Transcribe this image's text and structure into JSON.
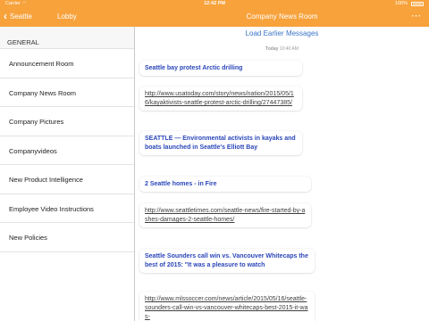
{
  "status_bar": {
    "carrier": "Carrier",
    "time": "12:42 PM",
    "battery": "100%"
  },
  "nav": {
    "back_label": "Seattle",
    "lobby_title": "Lobby",
    "room_title": "Company News Room",
    "more_icon": "ellipsis-icon"
  },
  "sidebar": {
    "section": "GENERAL",
    "items": [
      {
        "label": "Announcement Room"
      },
      {
        "label": "Company News Room"
      },
      {
        "label": "Company Pictures"
      },
      {
        "label": "Companyvideos"
      },
      {
        "label": "New Product Intelligence"
      },
      {
        "label": "Employee Video Instructions"
      },
      {
        "label": "New Policies"
      }
    ]
  },
  "chat": {
    "load_earlier": "Load Earlier Messages",
    "date_day": "Today",
    "date_time": "10:40 AM",
    "messages": [
      {
        "text": "Seattle bay protest Arctic drilling"
      },
      {
        "text": "http://www.usatoday.com/story/news/nation/2015/05/16/kayaktivists-seattle-protest-arctic-drilling/27447385/"
      },
      {
        "text": "SEATTLE — Environmental activists in kayaks and boats launched in Seattle's Elliott Bay"
      },
      {
        "text": "2 Seattle homes - in Fire"
      },
      {
        "text": "http://www.seattletimes.com/seattle-news/fire-started-by-ashes-damages-2-seattle-homes/"
      },
      {
        "text": "Seattle Sounders call win vs. Vancouver Whitecaps the best of 2015: \"It was a pleasure to watch"
      },
      {
        "text": "http://www.mlssoccer.com/news/article/2015/05/16/seattle-sounders-call-win-vs-vancouver-whitecaps-best-2015-it-was-"
      }
    ]
  },
  "colors": {
    "accent": "#f7a23b",
    "link": "#3b74c9",
    "headline": "#2a46b8"
  }
}
